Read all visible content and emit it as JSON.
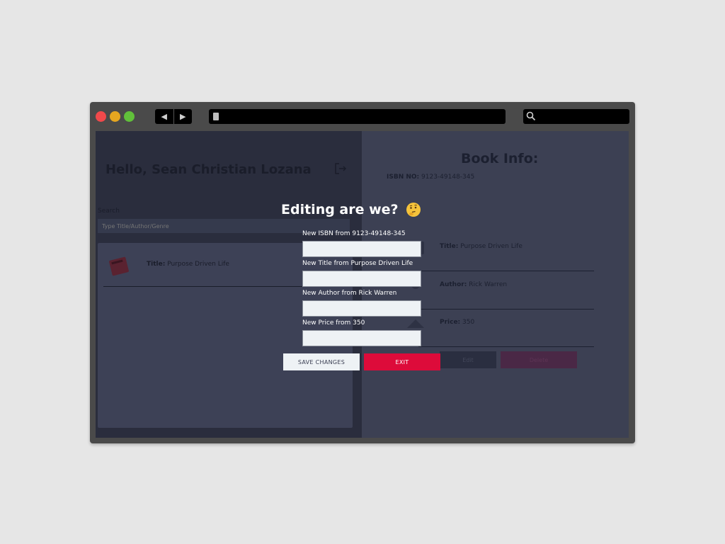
{
  "browser": {
    "back_glyph": "◀",
    "forward_glyph": "▶",
    "icons": [
      "close-dot",
      "minimize-dot",
      "maximize-dot",
      "document-icon",
      "search-icon"
    ]
  },
  "background_app": {
    "greeting": "Hello, Sean Christian Lozana",
    "search_label": "Search",
    "search_placeholder": "Type Title/Author/Genre",
    "list": [
      {
        "title_label": "Title:",
        "title_value": "Purpose Driven Life"
      }
    ],
    "book_info": {
      "heading": "Book Info:",
      "isbn_label": "ISBN NO:",
      "isbn_value": "9123-49148-345",
      "title_label": "Title:",
      "title_value": "Purpose Driven Life",
      "author_label": "Author:",
      "author_value": "Rick Warren",
      "price_label": "Price:",
      "price_value": "350",
      "edit_label": "Edit",
      "delete_label": "Delete"
    }
  },
  "modal": {
    "title": "Editing are we?",
    "emoji": "thinking-face-icon",
    "fields": [
      {
        "label": "New ISBN from 9123-49148-345",
        "value": ""
      },
      {
        "label": "New Title from Purpose Driven Life",
        "value": ""
      },
      {
        "label": "New Author from Rick Warren",
        "value": ""
      },
      {
        "label": "New Price from 350",
        "value": ""
      }
    ],
    "save_label": "SAVE CHANGES",
    "exit_label": "EXIT"
  },
  "colors": {
    "accent_exit": "#dd0b3a",
    "overlay": "#2a2d3d",
    "modal_text": "#ffffff"
  }
}
